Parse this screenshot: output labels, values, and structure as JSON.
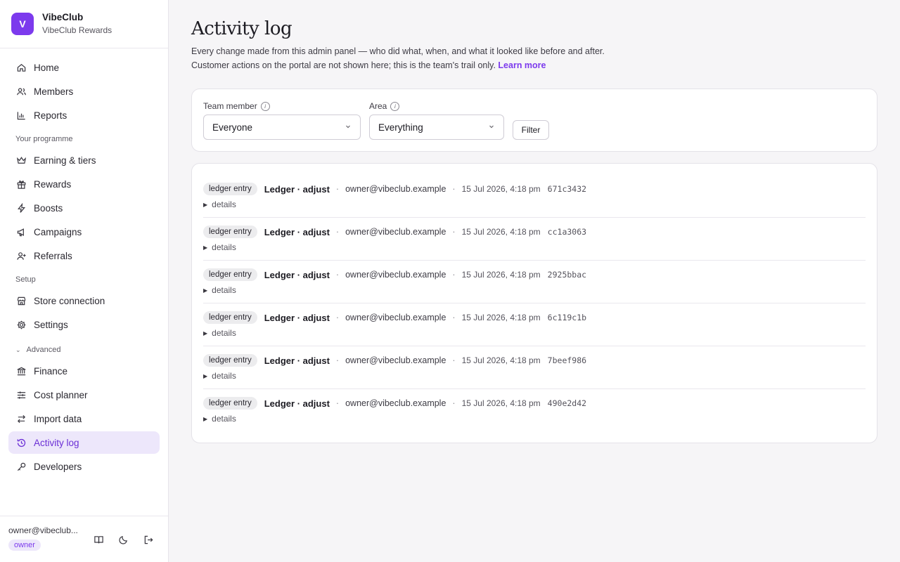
{
  "brand": {
    "initial": "V",
    "name": "VibeClub",
    "subtitle": "VibeClub Rewards"
  },
  "nav": {
    "home": "Home",
    "members": "Members",
    "reports": "Reports",
    "section_programme": "Your programme",
    "earning": "Earning & tiers",
    "rewards": "Rewards",
    "boosts": "Boosts",
    "campaigns": "Campaigns",
    "referrals": "Referrals",
    "section_setup": "Setup",
    "store": "Store connection",
    "settings": "Settings",
    "section_advanced": "Advanced",
    "finance": "Finance",
    "cost_planner": "Cost planner",
    "import_data": "Import data",
    "activity_log": "Activity log",
    "developers": "Developers"
  },
  "footer": {
    "email": "owner@vibeclub...",
    "role": "owner"
  },
  "page": {
    "title": "Activity log",
    "intro_line1": "Every change made from this admin panel — who did what, when, and what it looked like before and after.",
    "intro_line2": "Customer actions on the portal are not shown here; this is the team's trail only.",
    "learn_more": "Learn more"
  },
  "filters": {
    "member_label": "Team member",
    "member_value": "Everyone",
    "area_label": "Area",
    "area_value": "Everything",
    "filter_button": "Filter"
  },
  "log": {
    "rows": [
      {
        "tag": "ledger entry",
        "action": "Ledger · adjust",
        "who": "owner@vibeclub.example",
        "when": "15 Jul 2026, 4:18 pm",
        "hash": "671c3432",
        "details": "details"
      },
      {
        "tag": "ledger entry",
        "action": "Ledger · adjust",
        "who": "owner@vibeclub.example",
        "when": "15 Jul 2026, 4:18 pm",
        "hash": "cc1a3063",
        "details": "details"
      },
      {
        "tag": "ledger entry",
        "action": "Ledger · adjust",
        "who": "owner@vibeclub.example",
        "when": "15 Jul 2026, 4:18 pm",
        "hash": "2925bbac",
        "details": "details"
      },
      {
        "tag": "ledger entry",
        "action": "Ledger · adjust",
        "who": "owner@vibeclub.example",
        "when": "15 Jul 2026, 4:18 pm",
        "hash": "6c119c1b",
        "details": "details"
      },
      {
        "tag": "ledger entry",
        "action": "Ledger · adjust",
        "who": "owner@vibeclub.example",
        "when": "15 Jul 2026, 4:18 pm",
        "hash": "7beef986",
        "details": "details"
      },
      {
        "tag": "ledger entry",
        "action": "Ledger · adjust",
        "who": "owner@vibeclub.example",
        "when": "15 Jul 2026, 4:18 pm",
        "hash": "490e2d42",
        "details": "details"
      }
    ]
  },
  "colors": {
    "accent": "#7c3aed",
    "active_bg": "#ede7fb",
    "page_bg": "#f6f5f7"
  }
}
